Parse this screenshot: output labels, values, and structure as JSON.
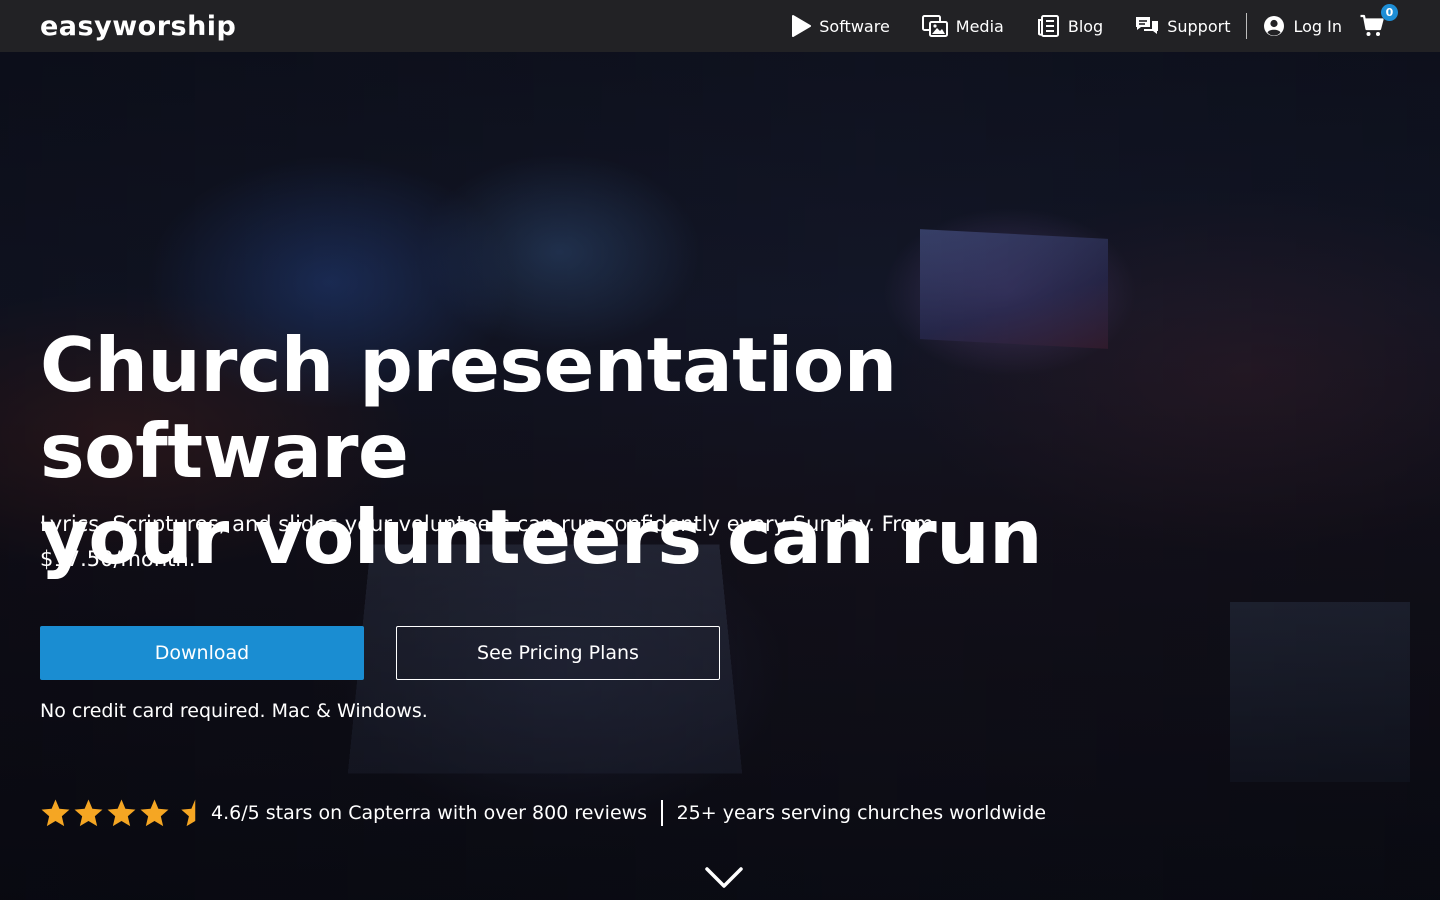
{
  "brand": {
    "logo_text": "easyworship",
    "accent_color": "#1a8dd2",
    "header_bg": "#222225"
  },
  "nav": {
    "items": [
      {
        "label": "Software",
        "icon": "play-icon"
      },
      {
        "label": "Media",
        "icon": "media-icon"
      },
      {
        "label": "Blog",
        "icon": "blog-icon"
      },
      {
        "label": "Support",
        "icon": "support-icon"
      }
    ],
    "login_label": "Log In",
    "login_icon": "user-circle-icon",
    "cart_icon": "cart-icon",
    "cart_count": "0"
  },
  "hero": {
    "title_line1": "Church presentation software",
    "title_line2": "your volunteers can run",
    "subtitle": "Lyrics, Scriptures, and slides your volunteers can run confidently every Sunday. From $17.50/month.",
    "primary_cta": "Download",
    "secondary_cta": "See Pricing Plans",
    "cta_note": "No credit card required. Mac & Windows.",
    "rating_value": 4.6,
    "rating_text": "4.6/5 stars on Capterra with over 800 reviews",
    "years_text": "25+ years serving churches worldwide",
    "star_color": "#f5a623",
    "scroll_icon": "chevron-down-icon"
  }
}
